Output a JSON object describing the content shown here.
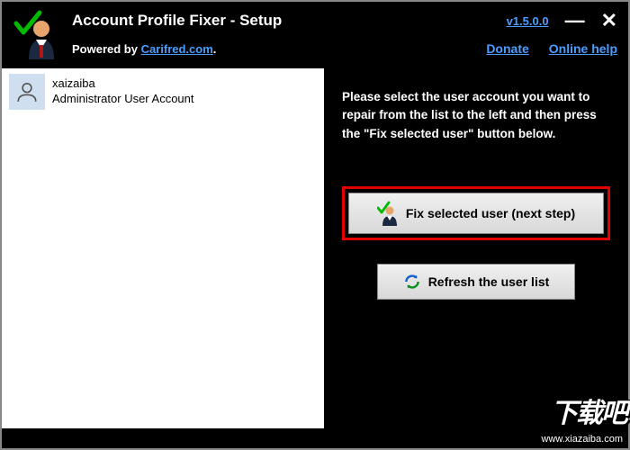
{
  "header": {
    "title": "Account Profile Fixer - Setup",
    "version": "v1.5.0.0",
    "powered_prefix": "Powered by ",
    "powered_link": "Carifred.com",
    "powered_suffix": ".",
    "donate": "Donate",
    "help": "Online help"
  },
  "users": [
    {
      "name": "xaizaiba",
      "type": "Administrator User Account",
      "selected": true
    }
  ],
  "panel": {
    "instruction": "Please select the user account you want to repair from the list to the left and then press the \"Fix selected user\" button below.",
    "fix_label": "Fix selected user (next step)",
    "refresh_label": "Refresh the user list"
  },
  "watermark": {
    "text": "下载吧",
    "url": "www.xiazaiba.com"
  }
}
